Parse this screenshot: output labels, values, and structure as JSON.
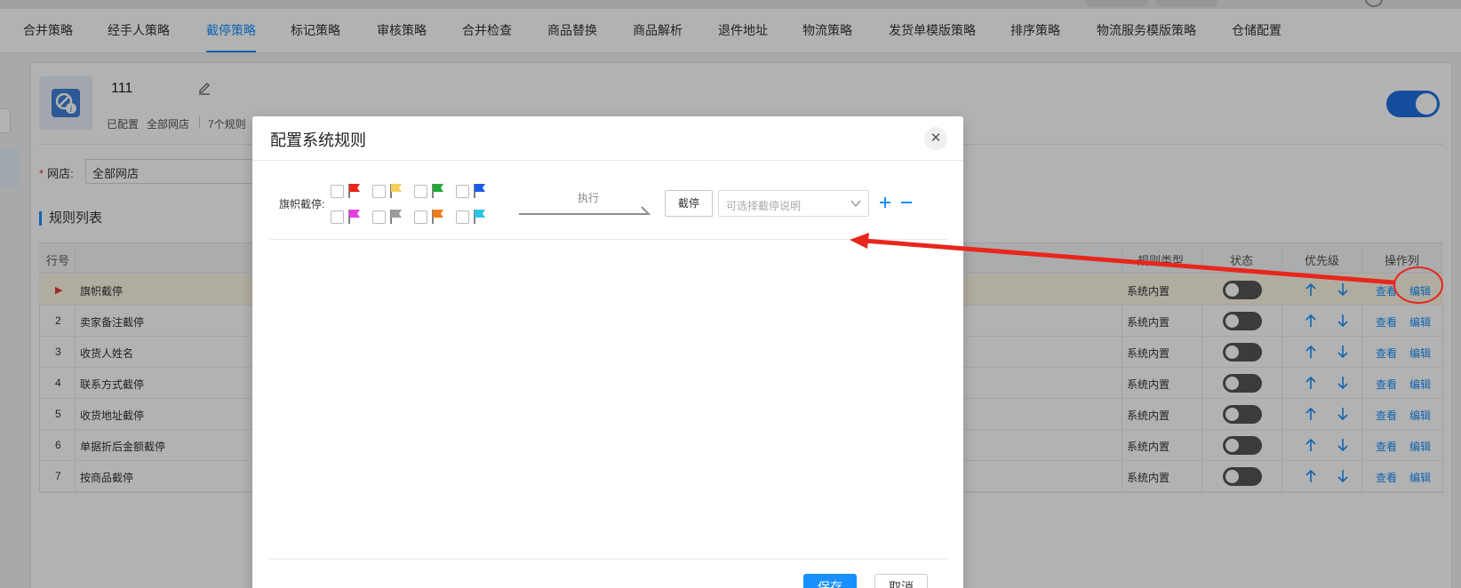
{
  "nav": {
    "tabs": [
      "合并策略",
      "经手人策略",
      "截停策略",
      "标记策略",
      "审核策略",
      "合并检查",
      "商品替换",
      "商品解析",
      "退件地址",
      "物流策略",
      "发货单模版策略",
      "排序策略",
      "物流服务模版策略",
      "仓储配置"
    ],
    "active_tab": "截停策略"
  },
  "strategy": {
    "name": "111",
    "status": "已配置",
    "shops": "全部网店",
    "rule_count": "7个规则",
    "enabled": true
  },
  "shop_filter": {
    "label": "网店:",
    "value": "全部网店"
  },
  "rules": {
    "title": "规则列表",
    "columns": [
      "行号",
      "规则类型",
      "状态",
      "优先级",
      "操作列"
    ],
    "view_label": "查看",
    "edit_label": "编辑",
    "rows": [
      {
        "no": "▶",
        "name": "旗帜截停",
        "type": "系统内置",
        "enabled": false
      },
      {
        "no": "2",
        "name": "卖家备注截停",
        "type": "系统内置",
        "enabled": false
      },
      {
        "no": "3",
        "name": "收货人姓名",
        "type": "系统内置",
        "enabled": false
      },
      {
        "no": "4",
        "name": "联系方式截停",
        "type": "系统内置",
        "enabled": false
      },
      {
        "no": "5",
        "name": "收货地址截停",
        "type": "系统内置",
        "enabled": false
      },
      {
        "no": "6",
        "name": "单据折后金额截停",
        "type": "系统内置",
        "enabled": false
      },
      {
        "no": "7",
        "name": "按商品截停",
        "type": "系统内置",
        "enabled": false
      }
    ]
  },
  "modal": {
    "title": "配置系统规则",
    "close_icon": "close-icon",
    "flag_label": "旗帜截停:",
    "flags": [
      {
        "color": "#e8261c",
        "checked": false
      },
      {
        "color": "#f5cf5c",
        "checked": false
      },
      {
        "color": "#22a83a",
        "checked": false
      },
      {
        "color": "#1f5ce6",
        "checked": false
      },
      {
        "color": "#e43ee0",
        "checked": false
      },
      {
        "color": "#9b9b9b",
        "checked": false
      },
      {
        "color": "#f07a1a",
        "checked": false
      },
      {
        "color": "#2ac4e6",
        "checked": false
      }
    ],
    "execute_label": "执行",
    "stop_button": "截停",
    "reason_placeholder": "可选择截停说明",
    "save_button": "保存",
    "cancel_button": "取消"
  },
  "colors": {
    "accent": "#1890ff",
    "toggle_on": "#1f6fe0",
    "annotation": "#e8261c"
  }
}
